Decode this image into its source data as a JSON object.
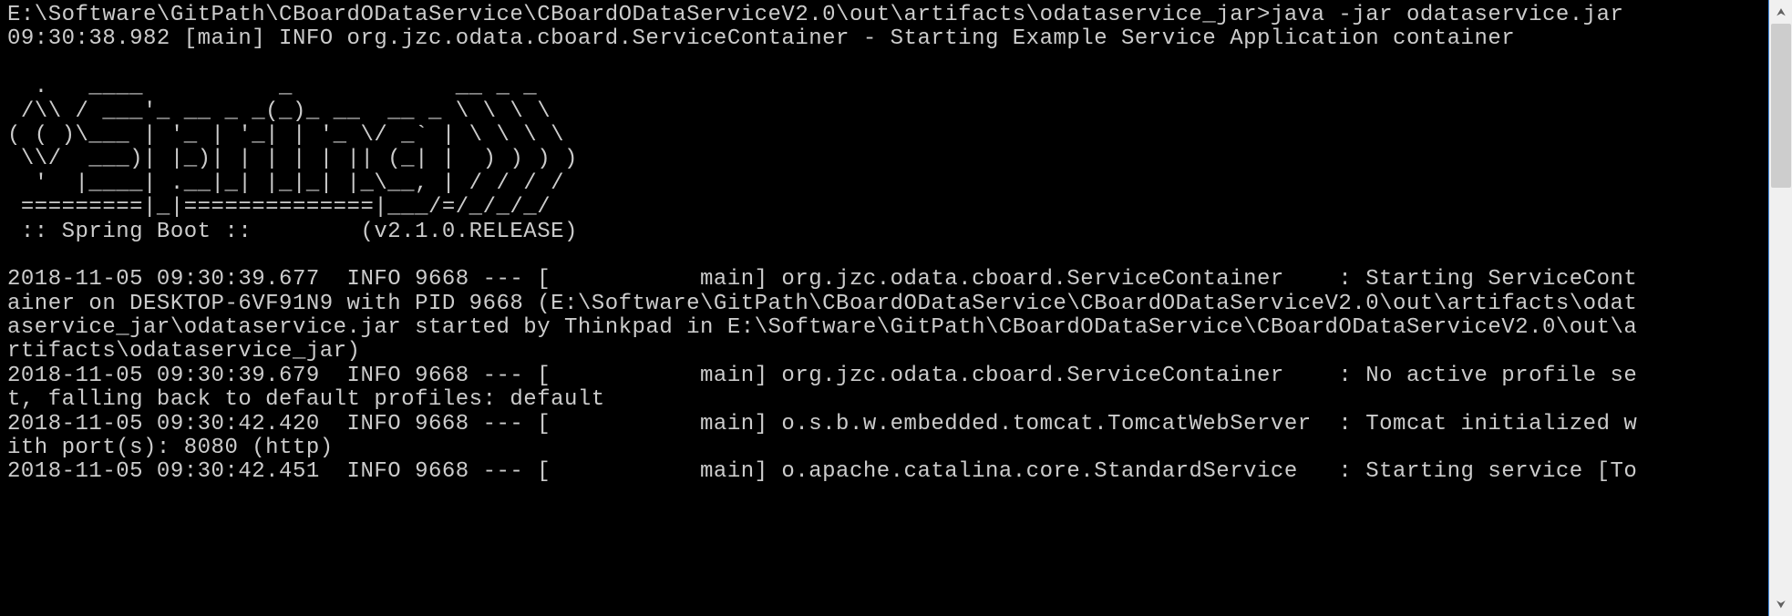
{
  "prompt_line": "E:\\Software\\GitPath\\CBoardODataService\\CBoardODataServiceV2.0\\out\\artifacts\\odataservice_jar>java -jar odataservice.jar",
  "log_line_1": "09:30:38.982 [main] INFO org.jzc.odata.cboard.ServiceContainer - Starting Example Service Application container",
  "ascii_art": "  .   ____          _            __ _ _\n /\\\\ / ___'_ __ _ _(_)_ __  __ _ \\ \\ \\ \\\n( ( )\\___ | '_ | '_| | '_ \\/ _` | \\ \\ \\ \\\n \\\\/  ___)| |_)| | | | | || (_| |  ) ) ) )\n  '  |____| .__|_| |_|_| |_\\__, | / / / /\n =========|_|==============|___/=/_/_/_/",
  "spring_boot_line": " :: Spring Boot ::        (v2.1.0.RELEASE)",
  "log_block": "2018-11-05 09:30:39.677  INFO 9668 --- [           main] org.jzc.odata.cboard.ServiceContainer    : Starting ServiceCont\nainer on DESKTOP-6VF91N9 with PID 9668 (E:\\Software\\GitPath\\CBoardODataService\\CBoardODataServiceV2.0\\out\\artifacts\\odat\naservice_jar\\odataservice.jar started by Thinkpad in E:\\Software\\GitPath\\CBoardODataService\\CBoardODataServiceV2.0\\out\\a\nrtifacts\\odataservice_jar)\n2018-11-05 09:30:39.679  INFO 9668 --- [           main] org.jzc.odata.cboard.ServiceContainer    : No active profile se\nt, falling back to default profiles: default\n2018-11-05 09:30:42.420  INFO 9668 --- [           main] o.s.b.w.embedded.tomcat.TomcatWebServer  : Tomcat initialized w\nith port(s): 8080 (http)\n2018-11-05 09:30:42.451  INFO 9668 --- [           main] o.apache.catalina.core.StandardService   : Starting service [To",
  "scrollbar": {
    "up_glyph": "⮝",
    "down_glyph": "⮟"
  }
}
